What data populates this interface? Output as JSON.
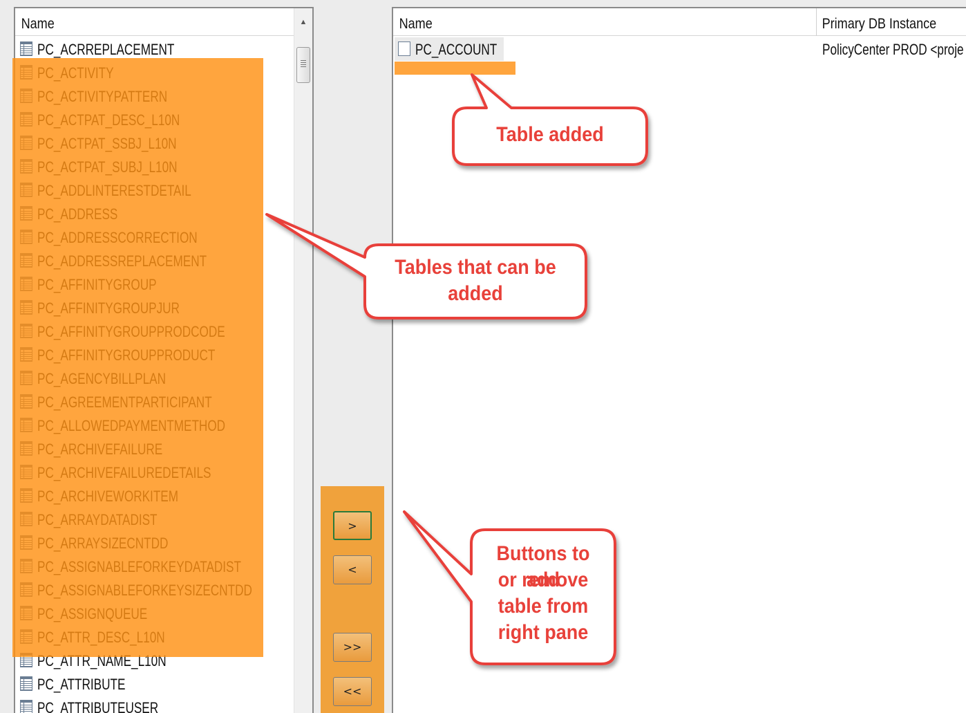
{
  "left_pane": {
    "header": "Name",
    "items": [
      "PC_ACRREPLACEMENT",
      "PC_ACTIVITY",
      "PC_ACTIVITYPATTERN",
      "PC_ACTPAT_DESC_L10N",
      "PC_ACTPAT_SSBJ_L10N",
      "PC_ACTPAT_SUBJ_L10N",
      "PC_ADDLINTERESTDETAIL",
      "PC_ADDRESS",
      "PC_ADDRESSCORRECTION",
      "PC_ADDRESSREPLACEMENT",
      "PC_AFFINITYGROUP",
      "PC_AFFINITYGROUPJUR",
      "PC_AFFINITYGROUPPRODCODE",
      "PC_AFFINITYGROUPPRODUCT",
      "PC_AGENCYBILLPLAN",
      "PC_AGREEMENTPARTICIPANT",
      "PC_ALLOWEDPAYMENTMETHOD",
      "PC_ARCHIVEFAILURE",
      "PC_ARCHIVEFAILUREDETAILS",
      "PC_ARCHIVEWORKITEM",
      "PC_ARRAYDATADIST",
      "PC_ARRAYSIZECNTDD",
      "PC_ASSIGNABLEFORKEYDATADIST",
      "PC_ASSIGNABLEFORKEYSIZECNTDD",
      "PC_ASSIGNQUEUE",
      "PC_ATTR_DESC_L10N",
      "PC_ATTR_NAME_L10N",
      "PC_ATTRIBUTE",
      "PC_ATTRIBUTEUSER"
    ]
  },
  "buttons": {
    "add": ">",
    "remove": "<",
    "add_all": ">>",
    "remove_all": "<<"
  },
  "right_pane": {
    "headers": {
      "name": "Name",
      "instance": "Primary DB Instance"
    },
    "rows": [
      {
        "name": "PC_ACCOUNT",
        "instance": "PolicyCenter PROD <proje"
      }
    ]
  },
  "callouts": {
    "table_added": "Table added",
    "tables_can_add_1": "Tables that can be",
    "tables_can_add_2": "added",
    "buttons_1": "Buttons to add",
    "buttons_2": "or remove",
    "buttons_3": "table from",
    "buttons_4": "right pane"
  },
  "colors": {
    "highlight": "#ff9114",
    "callout_border": "#e8413a",
    "callout_text": "#e8413a"
  },
  "icons": {
    "table_icon": "table-icon"
  }
}
